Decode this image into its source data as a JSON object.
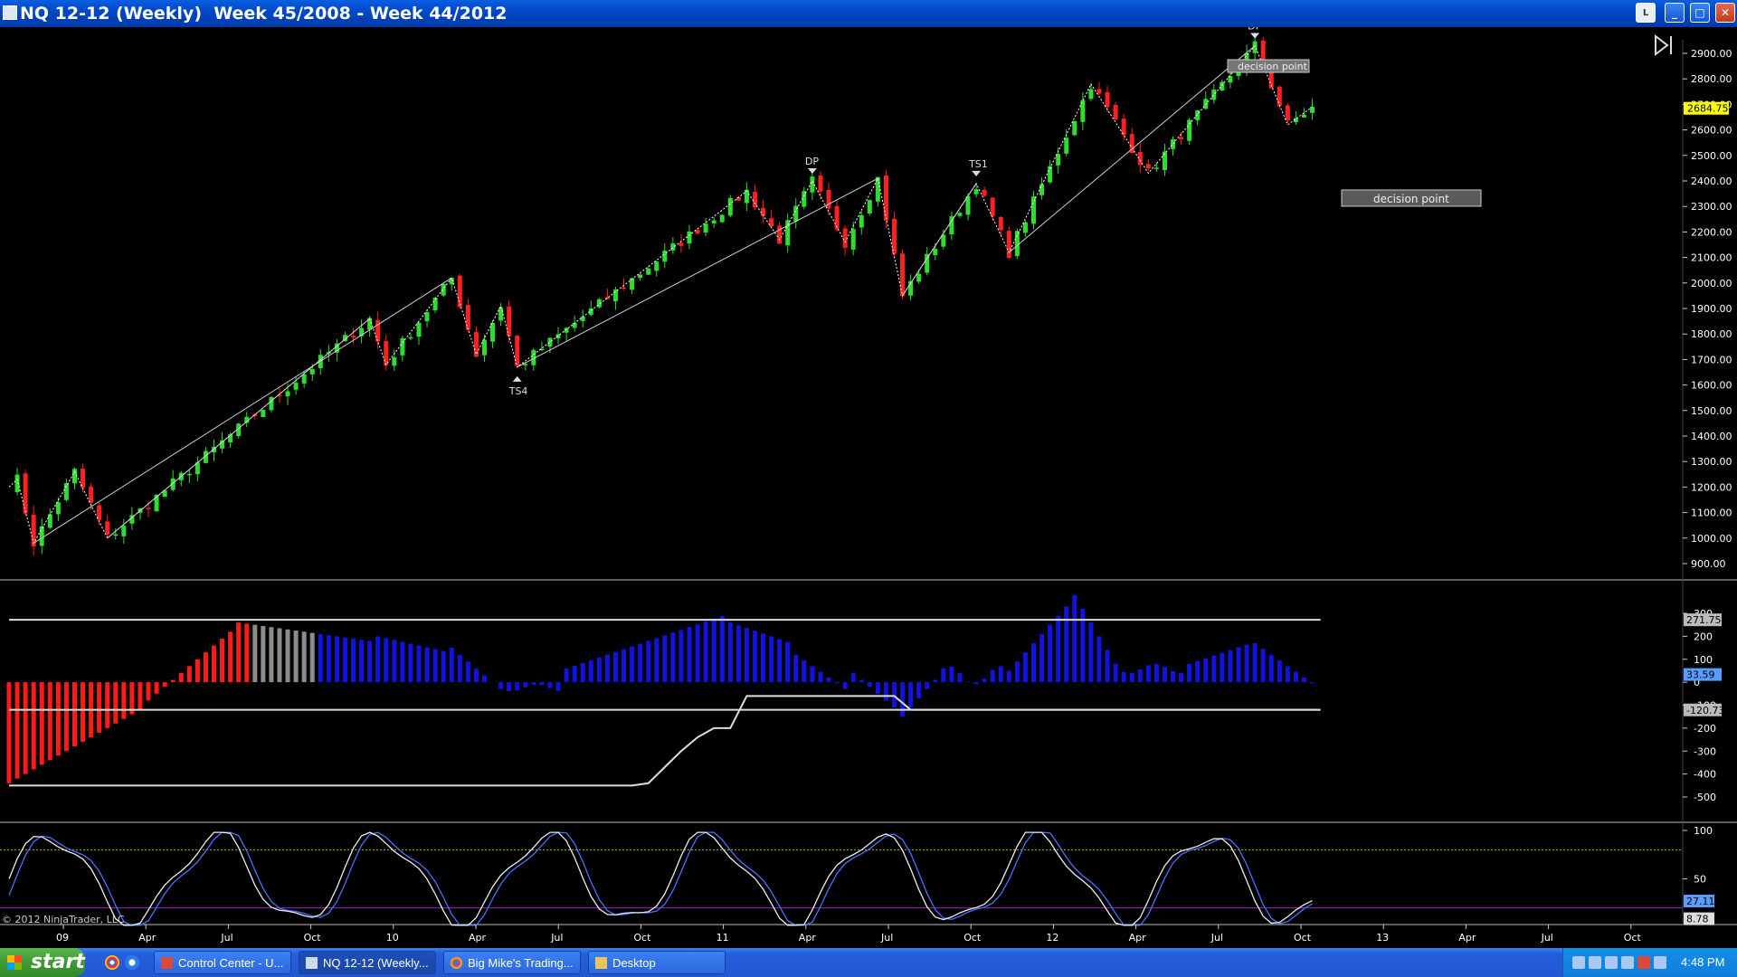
{
  "window": {
    "title": "NQ 12-12 (Weekly)  Week 45/2008 - Week 44/2012",
    "buttons": {
      "link": "L",
      "minimize": "_",
      "maximize": "□",
      "close": "✕"
    }
  },
  "colors": {
    "up": "#2fdc2f",
    "down": "#ff2020",
    "hist_red": "#ff1a1a",
    "hist_gray": "#8c8c8c",
    "hist_blue": "#1212e0",
    "stoch_blue": "#4a6fff",
    "price_marker": "#ffff00",
    "grid_yellow": "#b8b800",
    "grid_purple": "#a020c0"
  },
  "price_panel": {
    "y_ticks": [
      "2900.00",
      "2800.00",
      "2700.00",
      "2600.00",
      "2500.00",
      "2400.00",
      "2300.00",
      "2200.00",
      "2100.00",
      "2000.00",
      "1900.00",
      "1800.00",
      "1700.00",
      "1600.00",
      "1500.00",
      "1400.00",
      "1300.00",
      "1200.00",
      "1100.00",
      "1000.00",
      "900.00"
    ],
    "last_price": "2684.75",
    "annotations": [
      {
        "id": "TS4",
        "label": "TS4",
        "pos": "below"
      },
      {
        "id": "DP1",
        "label": "DP",
        "pos": "above"
      },
      {
        "id": "TS1",
        "label": "TS1",
        "pos": "above"
      },
      {
        "id": "DP2",
        "label": "DP",
        "pos": "above"
      }
    ],
    "decision_box_top": "decision point",
    "decision_box_right": "decision point"
  },
  "histogram_panel": {
    "y_ticks": [
      "300",
      "200",
      "100",
      "0",
      "-100",
      "-200",
      "-300",
      "-400",
      "-500"
    ],
    "markers": {
      "upper": "271.75",
      "current": "33.59",
      "lower": "-120.73"
    }
  },
  "stoch_panel": {
    "y_ticks": [
      "100",
      "50"
    ],
    "markers": {
      "a": "27.11",
      "b": "8.78"
    },
    "copyright": "© 2012 NinjaTrader, LLC"
  },
  "x_axis": [
    "09",
    "Apr",
    "Jul",
    "Oct",
    "10",
    "Apr",
    "Jul",
    "Oct",
    "11",
    "Apr",
    "Jul",
    "Oct",
    "12",
    "Apr",
    "Jul",
    "Oct",
    "13",
    "Apr",
    "Jul",
    "Oct"
  ],
  "chart_data": {
    "type": "candlestick",
    "instrument": "NQ 12-12",
    "timeframe": "Weekly",
    "zigzag_pivots": [
      [
        0,
        1200
      ],
      [
        1,
        1230
      ],
      [
        3,
        980
      ],
      [
        8,
        1260
      ],
      [
        12,
        1000
      ],
      [
        44,
        1860
      ],
      [
        46,
        1680
      ],
      [
        54,
        2020
      ],
      [
        57,
        1720
      ],
      [
        60,
        1910
      ],
      [
        62,
        1670
      ],
      [
        90,
        2360
      ],
      [
        94,
        2170
      ],
      [
        98,
        2400
      ],
      [
        102,
        2160
      ],
      [
        106,
        2410
      ],
      [
        109,
        1950
      ],
      [
        118,
        2390
      ],
      [
        122,
        2120
      ],
      [
        132,
        2780
      ],
      [
        139,
        2430
      ],
      [
        152,
        2930
      ],
      [
        156,
        2620
      ],
      [
        159,
        2690
      ]
    ],
    "trendlines": [
      [
        [
          3,
          980
        ],
        [
          54,
          2020
        ]
      ],
      [
        [
          12,
          1000
        ],
        [
          44,
          1860
        ]
      ],
      [
        [
          62,
          1670
        ],
        [
          106,
          2410
        ]
      ],
      [
        [
          109,
          1950
        ],
        [
          118,
          2390
        ]
      ],
      [
        [
          122,
          2120
        ],
        [
          152,
          2930
        ]
      ]
    ],
    "histogram_line": [
      [
        0,
        -450
      ],
      [
        14,
        -450
      ],
      [
        76,
        -450
      ],
      [
        78,
        -440
      ],
      [
        82,
        -300
      ],
      [
        84,
        -240
      ],
      [
        86,
        -200
      ],
      [
        88,
        -200
      ],
      [
        90,
        -60
      ],
      [
        100,
        -60
      ],
      [
        108,
        -60
      ],
      [
        110,
        -120
      ],
      [
        160,
        -120
      ]
    ],
    "stoch_levels": {
      "upper": 80,
      "lower": 20
    }
  }
}
